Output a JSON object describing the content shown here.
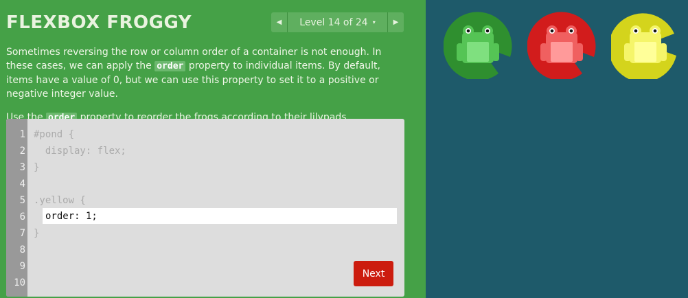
{
  "header": {
    "title": "FLEXBOX FROGGY",
    "level_label": "Level 14 of 24",
    "prev_glyph": "◀",
    "next_glyph": "▶",
    "caret_glyph": "▾"
  },
  "instructions": {
    "p1_a": "Sometimes reversing the row or column order of a container is not enough. In these cases, we can apply the ",
    "p1_code": "order",
    "p1_b": " property to individual items. By default, items have a value of 0, but we can use this property to set it to a positive or negative integer value.",
    "p2_a": "Use the ",
    "p2_code": "order",
    "p2_b": " property to reorder the frogs according to their lilypads."
  },
  "editor": {
    "line_numbers": [
      "1",
      "2",
      "3",
      "4",
      "5",
      "6",
      "7",
      "8",
      "9",
      "10"
    ],
    "lines": [
      "#pond {",
      "  display: flex;",
      "}",
      "",
      ".yellow {",
      "",
      "}"
    ],
    "input_value": "order: 1;",
    "next_label": "Next"
  },
  "pond": {
    "lilypads": [
      {
        "color_name": "green",
        "pad": "#2f8f2f",
        "frog": "#55c455",
        "belly": "#7fe07f"
      },
      {
        "color_name": "red",
        "pad": "#d21c1c",
        "frog": "#f06060",
        "belly": "#ff9a9a"
      },
      {
        "color_name": "yellow",
        "pad": "#d4d41c",
        "frog": "#f5f56a",
        "belly": "#ffff99"
      }
    ]
  },
  "colors": {
    "sidebar_bg": "#45a147",
    "pond_bg": "#1e5a6a",
    "next_button": "#cc1c0e"
  }
}
